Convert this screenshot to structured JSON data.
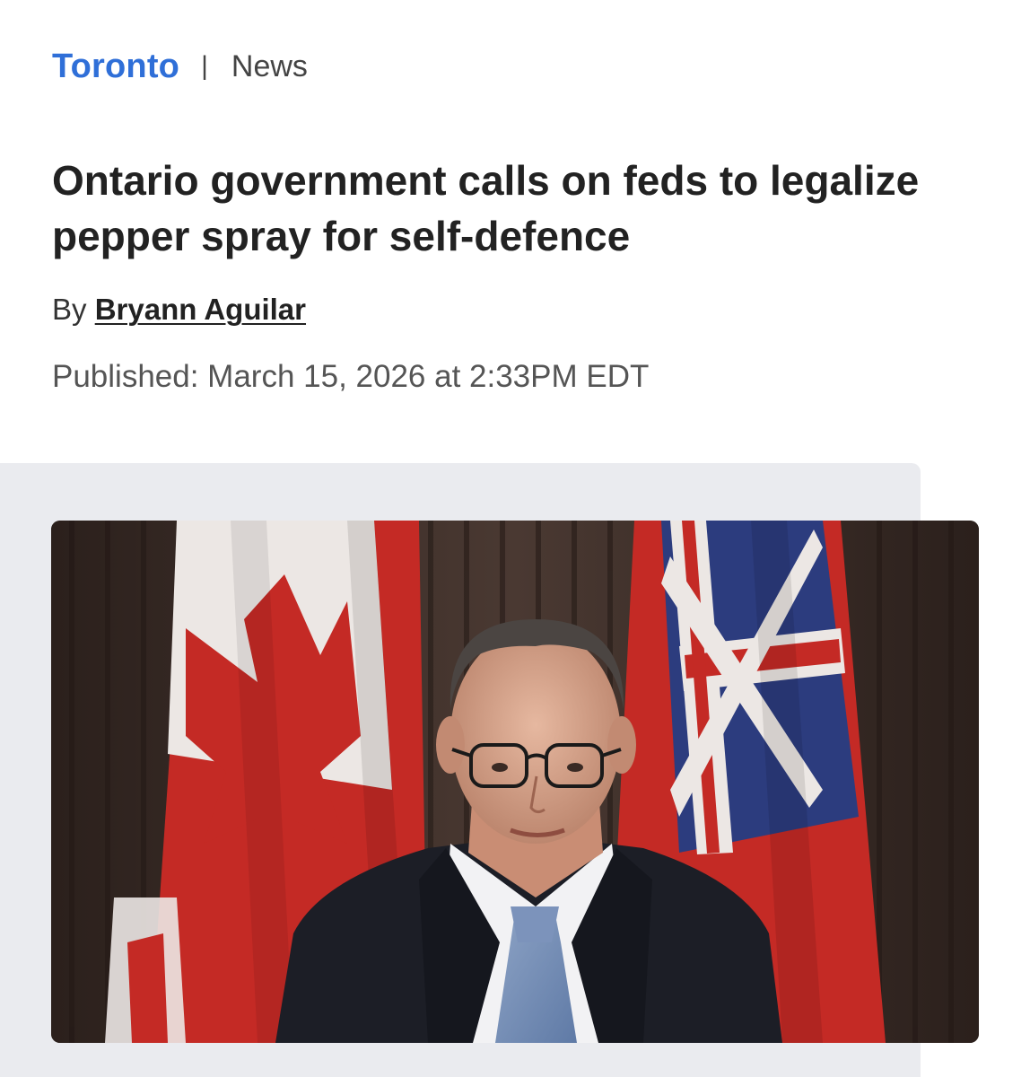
{
  "breadcrumb": {
    "section": "Toronto",
    "separator": "|",
    "subsection": "News"
  },
  "article": {
    "headline": "Ontario government calls on feds to legalize pepper spray for self-defence",
    "byline_prefix": "By",
    "author": "Bryann Aguilar",
    "published": "Published: March 15, 2026 at 2:33PM EDT"
  },
  "colors": {
    "link_blue": "#2f6fd8",
    "flag_red": "#c42a25",
    "panel_gray": "#eaebef"
  },
  "media": {
    "icon": "photo-image"
  }
}
